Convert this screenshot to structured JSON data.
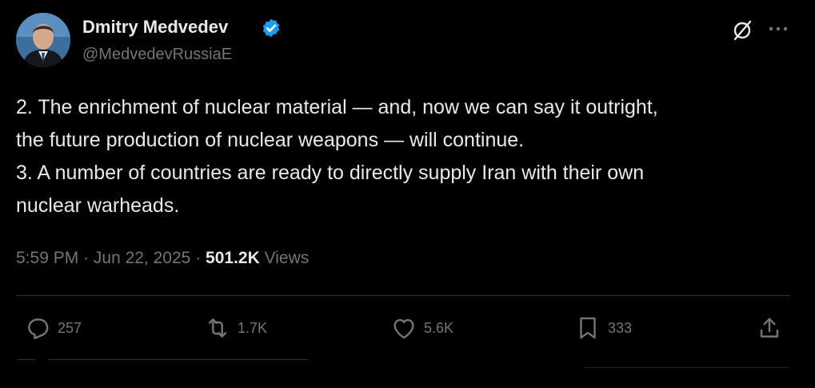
{
  "author": {
    "display_name": "Dmitry Medvedev",
    "handle": "@MedvedevRussiaE",
    "verified": true
  },
  "icons": {
    "verified": "verified-badge-icon",
    "grok": "grok-icon",
    "more": "more-options-icon",
    "reply": "reply-icon",
    "retweet": "retweet-icon",
    "like": "like-icon",
    "bookmark": "bookmark-icon",
    "share": "share-icon"
  },
  "tweet": {
    "lines": [
      "2. The enrichment of nuclear material — and, now we can say it outright,",
      "the future production of nuclear weapons — will continue.",
      "3. A number of countries are ready to directly supply Iran with their own",
      "nuclear warheads."
    ]
  },
  "meta": {
    "time": "5:59 PM",
    "date": "Jun 22, 2025",
    "views_count": "501.2K",
    "views_label": "Views",
    "separator": "·"
  },
  "actions": {
    "reply_count": "257",
    "retweet_count": "1.7K",
    "like_count": "5.6K",
    "bookmark_count": "333"
  },
  "colors": {
    "background": "#000000",
    "text_primary": "#e7e9ea",
    "text_secondary": "#71767b",
    "divider": "#2f3336",
    "verified_badge": "#1d9bf0"
  }
}
